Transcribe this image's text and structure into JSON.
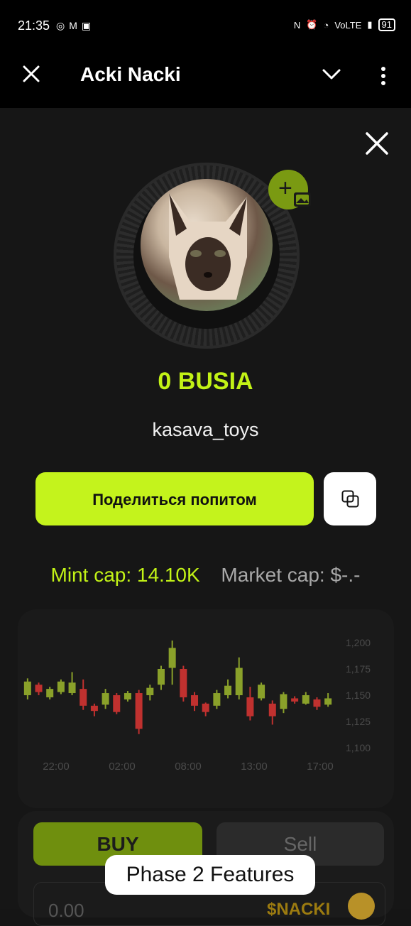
{
  "status_bar": {
    "time": "21:35",
    "app_icons": [
      "instagram-icon",
      "gmail-icon",
      "notification-app-icon"
    ],
    "right_icons": [
      "nfc-icon",
      "alarm-icon",
      "wifi-icon",
      "volte-icon",
      "signal-icon"
    ],
    "volte_label": "VoLTE",
    "battery": "91"
  },
  "app_bar": {
    "title": "Acki Nacki"
  },
  "profile": {
    "balance": "0 BUSIA",
    "username": "kasava_toys"
  },
  "actions": {
    "share_label": "Поделиться попитом"
  },
  "caps": {
    "mint": "Mint cap: 14.10K",
    "market": "Market cap: $-.-"
  },
  "chart_data": {
    "type": "candlestick",
    "x_ticks": [
      "22:00",
      "02:00",
      "08:00",
      "13:00",
      "17:00"
    ],
    "y_ticks": [
      "1,200",
      "1,175",
      "1,150",
      "1,125",
      "1,100"
    ],
    "ylim": [
      1100,
      1200
    ],
    "candles": [
      {
        "open": 1150,
        "close": 1163,
        "high": 1166,
        "low": 1146
      },
      {
        "open": 1160,
        "close": 1153,
        "high": 1162,
        "low": 1150
      },
      {
        "open": 1148,
        "close": 1156,
        "high": 1158,
        "low": 1146
      },
      {
        "open": 1153,
        "close": 1163,
        "high": 1165,
        "low": 1151
      },
      {
        "open": 1152,
        "close": 1162,
        "high": 1172,
        "low": 1150
      },
      {
        "open": 1156,
        "close": 1140,
        "high": 1165,
        "low": 1136
      },
      {
        "open": 1140,
        "close": 1135,
        "high": 1142,
        "low": 1130
      },
      {
        "open": 1141,
        "close": 1152,
        "high": 1156,
        "low": 1137
      },
      {
        "open": 1150,
        "close": 1134,
        "high": 1152,
        "low": 1132
      },
      {
        "open": 1146,
        "close": 1152,
        "high": 1154,
        "low": 1144
      },
      {
        "open": 1152,
        "close": 1118,
        "high": 1155,
        "low": 1113
      },
      {
        "open": 1150,
        "close": 1157,
        "high": 1160,
        "low": 1145
      },
      {
        "open": 1160,
        "close": 1175,
        "high": 1178,
        "low": 1155
      },
      {
        "open": 1176,
        "close": 1195,
        "high": 1202,
        "low": 1160
      },
      {
        "open": 1175,
        "close": 1148,
        "high": 1178,
        "low": 1144
      },
      {
        "open": 1150,
        "close": 1140,
        "high": 1153,
        "low": 1135
      },
      {
        "open": 1142,
        "close": 1134,
        "high": 1143,
        "low": 1130
      },
      {
        "open": 1140,
        "close": 1152,
        "high": 1155,
        "low": 1137
      },
      {
        "open": 1150,
        "close": 1159,
        "high": 1165,
        "low": 1147
      },
      {
        "open": 1150,
        "close": 1176,
        "high": 1186,
        "low": 1146
      },
      {
        "open": 1148,
        "close": 1130,
        "high": 1158,
        "low": 1126
      },
      {
        "open": 1147,
        "close": 1160,
        "high": 1162,
        "low": 1145
      },
      {
        "open": 1142,
        "close": 1130,
        "high": 1145,
        "low": 1122
      },
      {
        "open": 1137,
        "close": 1151,
        "high": 1153,
        "low": 1133
      },
      {
        "open": 1147,
        "close": 1144,
        "high": 1149,
        "low": 1142
      },
      {
        "open": 1142,
        "close": 1150,
        "high": 1153,
        "low": 1141
      },
      {
        "open": 1146,
        "close": 1139,
        "high": 1148,
        "low": 1136
      },
      {
        "open": 1141,
        "close": 1147,
        "high": 1152,
        "low": 1139
      }
    ],
    "colors": {
      "up": "#8aa12a",
      "down": "#c0312f"
    }
  },
  "trade": {
    "buy_label": "BUY",
    "sell_label": "Sell",
    "amount_value": "0.00",
    "token_label": "$NACKI"
  },
  "toast": {
    "text": "Phase 2 Features"
  }
}
